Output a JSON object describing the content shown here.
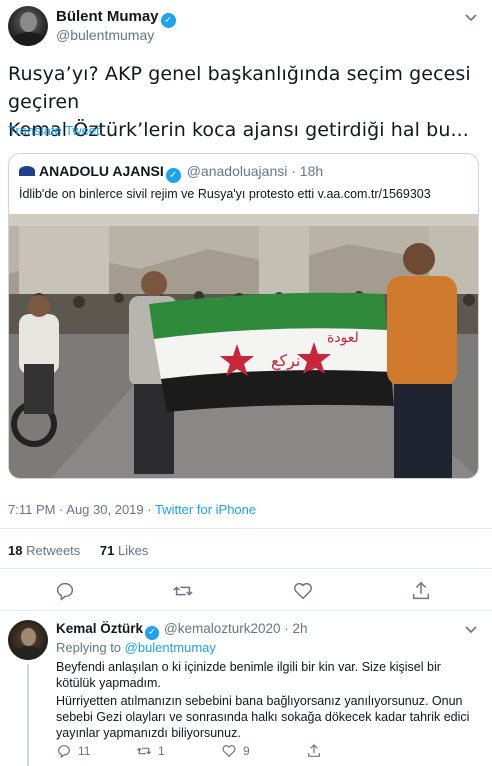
{
  "main_tweet": {
    "author_name": "Bülent Mumay",
    "author_handle": "@bulentmumay",
    "verified_glyph": "✓",
    "text_line1": "Rusya’yı? AKP genel başkanlığında seçim gecesi geçiren",
    "text_line2": "Kemal Öztürk’lerin koca ajansı getirdiği hal bu...",
    "translate_label": "Translate Tweet",
    "timestamp": "7:11 PM · Aug 30, 2019 · ",
    "source": "Twitter for iPhone",
    "retweets_count": "18",
    "retweets_label": "Retweets",
    "likes_count": "71",
    "likes_label": "Likes"
  },
  "quoted_tweet": {
    "author_name": "ANADOLU AJANSI",
    "author_handle": "@anadoluajansi",
    "separator": " · ",
    "time": "18h",
    "text": "İdlib'de on binlerce sivil rejim ve Rusya'yı protesto etti v.aa.com.tr/1569303",
    "flag_text": "لن نركع",
    "flag_text2": "لعودة"
  },
  "reply_tweet": {
    "author_name": "Kemal Öztürk",
    "author_handle": "@kemalozturk2020",
    "separator": " · ",
    "time": "2h",
    "replying_prefix": "Replying to ",
    "replying_handle": "@bulentmumay",
    "paragraph1": "Beyfendi anlaşılan o ki içinizde benimle ilgili bir kin var. Size kişisel bir kötülük yapmadım.",
    "paragraph2": "Hürriyetten atılmanızın sebebini bana bağlıyorsanız yanılıyorsunuz. Onun sebebi Gezi olayları ve sonrasında halkı sokağa dökecek kadar tahrik edici yayınlar yapmanızdı biliyorsunuz.",
    "reply_count": "11",
    "retweet_count": "1",
    "like_count": "9"
  },
  "icons": [
    "chevron-down-icon",
    "verified-icon",
    "reply-icon",
    "retweet-icon",
    "like-icon",
    "share-icon"
  ],
  "colors": {
    "accent": "#1da1f2",
    "muted": "#657786",
    "border": "#e6ecf0"
  }
}
